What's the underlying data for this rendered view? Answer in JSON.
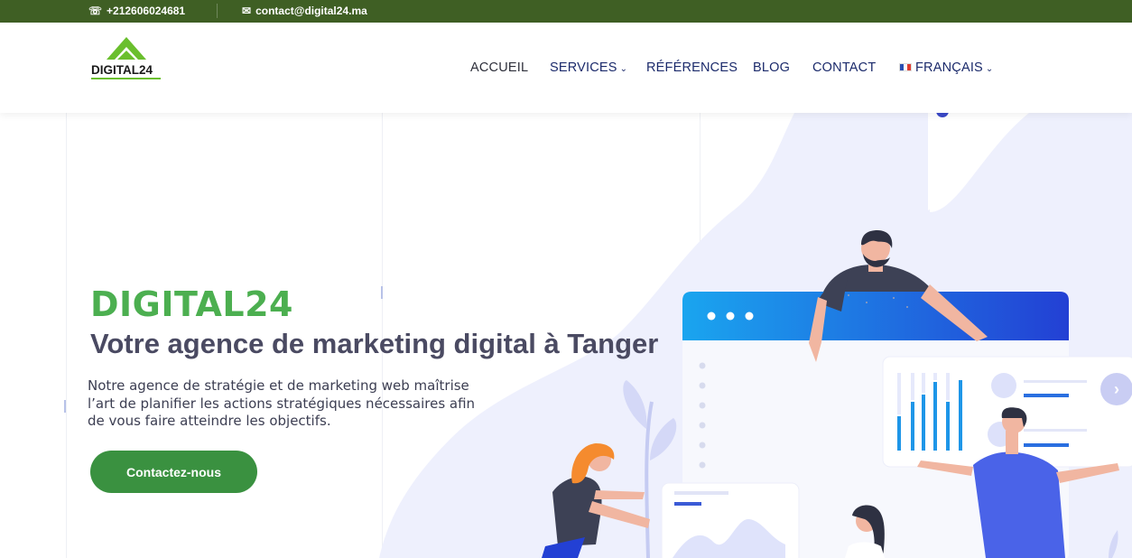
{
  "topbar": {
    "phone": "+212606024681",
    "email": "contact@digital24.ma",
    "phone_icon": "phone-icon",
    "email_icon": "envelope-icon"
  },
  "header": {
    "logo_text": "DIGITAL24",
    "nav": [
      {
        "label": "ACCUEIL",
        "has_dropdown": false
      },
      {
        "label": "SERVICES",
        "has_dropdown": true
      },
      {
        "label": "RÉFÉRENCES",
        "has_dropdown": false
      },
      {
        "label": "BLOG",
        "has_dropdown": false
      },
      {
        "label": "CONTACT",
        "has_dropdown": false
      },
      {
        "label": "FRANÇAIS",
        "has_dropdown": true,
        "flag": "french-flag-icon"
      }
    ]
  },
  "hero": {
    "title": "DIGITAL24",
    "subtitle": "Votre agence de marketing digital à Tanger",
    "text": "Notre agence de stratégie et de marketing web maîtrise l’art de planifier les actions stratégiques nécessaires afin de vous faire atteindre les objectifs.",
    "cta_label": "Contactez-nous",
    "next_icon": "chevron-right-icon"
  },
  "colors": {
    "topbar": "#3f5f24",
    "brand_green": "#4caf50",
    "cta": "#3a9140",
    "nav": "#1b2a6b"
  }
}
